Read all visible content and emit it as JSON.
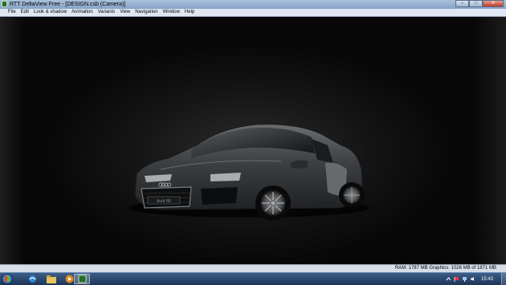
{
  "window": {
    "title": "RTT DeltaView Free - [DESIGN.csb (Camera)]",
    "controls": {
      "minimize": "–",
      "maximize": "□",
      "close": "✕"
    }
  },
  "menu": [
    "File",
    "Edit",
    "Look & shadow",
    "Animation",
    "Variants",
    "View",
    "Navigation",
    "Window",
    "Help"
  ],
  "viewport": {
    "license_plate": "Audi R8"
  },
  "status": {
    "memory": "RAM: 1787 MB Graphics: 1026 MB of 1871 MB"
  },
  "taskbar": {
    "apps": [
      "internet-explorer-icon",
      "folder-icon",
      "media-player-icon",
      "deltaview-app-icon"
    ],
    "tray_icons": [
      "notification-chevron-icon",
      "flag-icon",
      "network-icon",
      "volume-icon"
    ],
    "clock": "15:43"
  },
  "colors": {
    "title_bar": "#a8c0dc",
    "menu_bar": "#dfe7f2",
    "taskbar": "#1c3558",
    "car_body": "#3a3d40"
  }
}
